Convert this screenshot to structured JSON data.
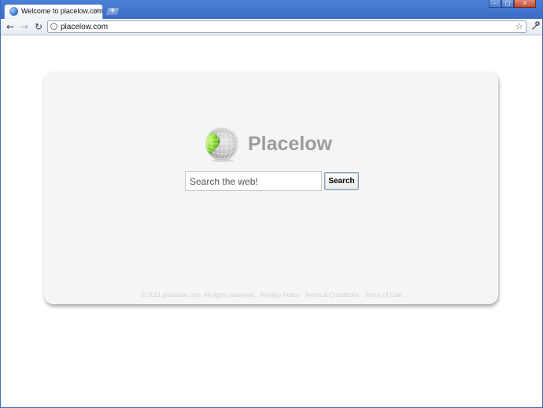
{
  "browser": {
    "tab_title": "Welcome to placelow.com",
    "tab_close": "×",
    "new_tab": "+",
    "window_controls": {
      "minimize": "–",
      "maximize": "□",
      "close": "x"
    },
    "toolbar": {
      "back_icon": "back-arrow-icon",
      "forward_icon": "forward-arrow-icon",
      "reload_icon": "reload-icon",
      "wrench_icon": "wrench-icon",
      "back": "←",
      "forward": "→",
      "reload": "↻",
      "wrench": "🔧"
    },
    "url": "placelow.com",
    "star": "☆"
  },
  "page": {
    "logo_text": "Placelow",
    "search_placeholder": "Search the web!",
    "search_value": "",
    "search_button_label": "Search",
    "footer": {
      "copyright": "© 2011 placelow.com. All rights reserved.",
      "links": [
        "Privacy Policy",
        "Terms & Conditions",
        "Terms of Use"
      ]
    }
  },
  "colors": {
    "titlebar": "#3a6cc6",
    "logo_text": "#9c9c9c",
    "card_bg": "#f5f5f5",
    "globe_green": "#7ed321"
  }
}
